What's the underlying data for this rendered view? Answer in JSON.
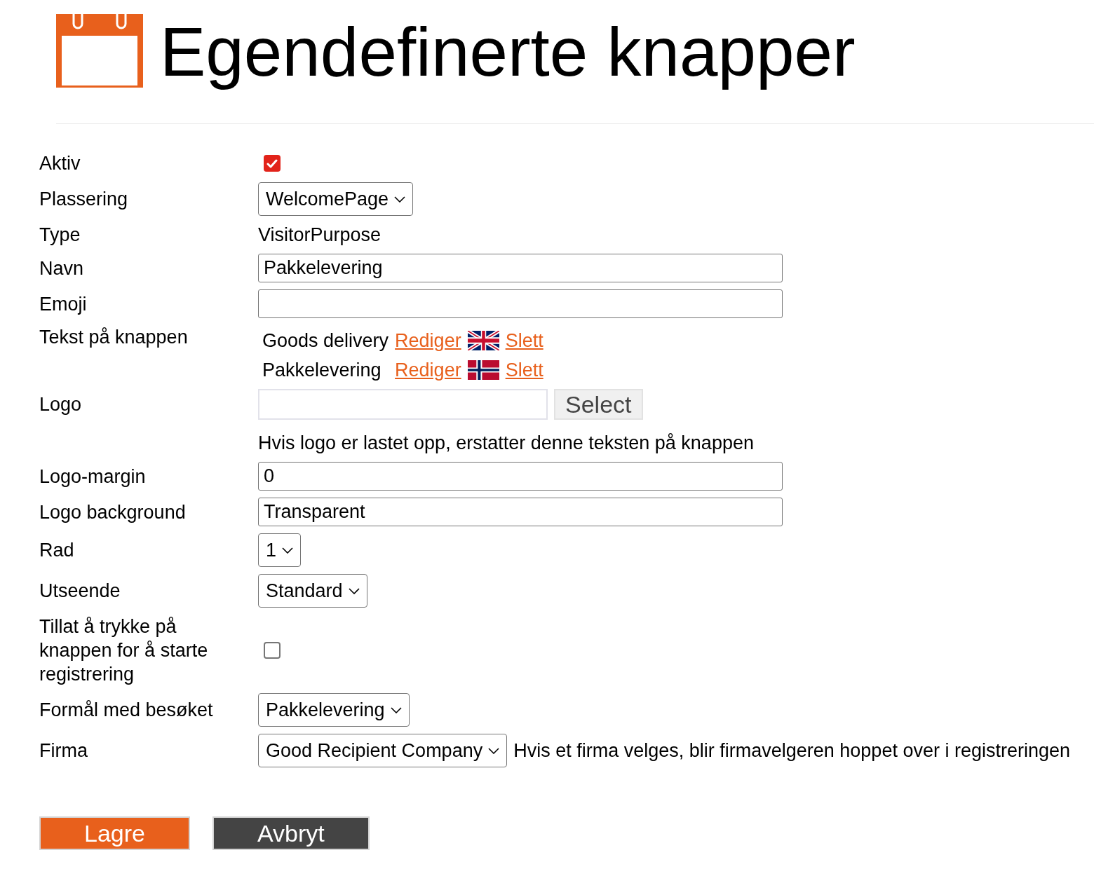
{
  "header": {
    "title": "Egendefinerte knapper"
  },
  "fields": [
    {
      "kind": "checkbox",
      "label": "Aktiv",
      "checked": true
    },
    {
      "kind": "select",
      "label": "Plassering",
      "value": "WelcomePage"
    },
    {
      "kind": "text",
      "label": "Type",
      "value": "VisitorPurpose"
    },
    {
      "kind": "input",
      "label": "Navn",
      "value": "Pakkelevering"
    },
    {
      "kind": "input",
      "label": "Emoji"
    },
    {
      "kind": "translations",
      "label": "Tekst på knappen",
      "translations": [
        {
          "kind": "british",
          "text": "Goods delivery",
          "edit": "Rediger",
          "delete": "Slett"
        },
        {
          "kind": "norwegian",
          "text": "Pakkelevering",
          "edit": "Rediger",
          "delete": "Slett"
        }
      ]
    },
    {
      "kind": "file",
      "label": "Logo",
      "button": "Select",
      "hint": "Hvis logo er lastet opp, erstatter denne teksten på knappen"
    },
    {
      "kind": "input",
      "label": "Logo-margin",
      "value": "0"
    },
    {
      "kind": "input",
      "label": "Logo background",
      "value": "Transparent"
    },
    {
      "kind": "select",
      "label": "Rad",
      "value": "1"
    },
    {
      "kind": "select",
      "label": "Utseende",
      "value": "Standard"
    },
    {
      "kind": "checkbox",
      "label": "Tillat å trykke på knappen for å starte registrering",
      "checked": false
    },
    {
      "kind": "select",
      "label": "Formål med besøket",
      "value": "Pakkelevering"
    },
    {
      "kind": "select",
      "label": "Firma",
      "value": "Good Recipient Company",
      "note": "Hvis et firma velges, blir firmavelgeren hoppet over i registreringen"
    }
  ],
  "actions": [
    {
      "kind": "primary",
      "label": "Lagre"
    },
    {
      "kind": "secondary",
      "label": "Avbryt"
    }
  ]
}
